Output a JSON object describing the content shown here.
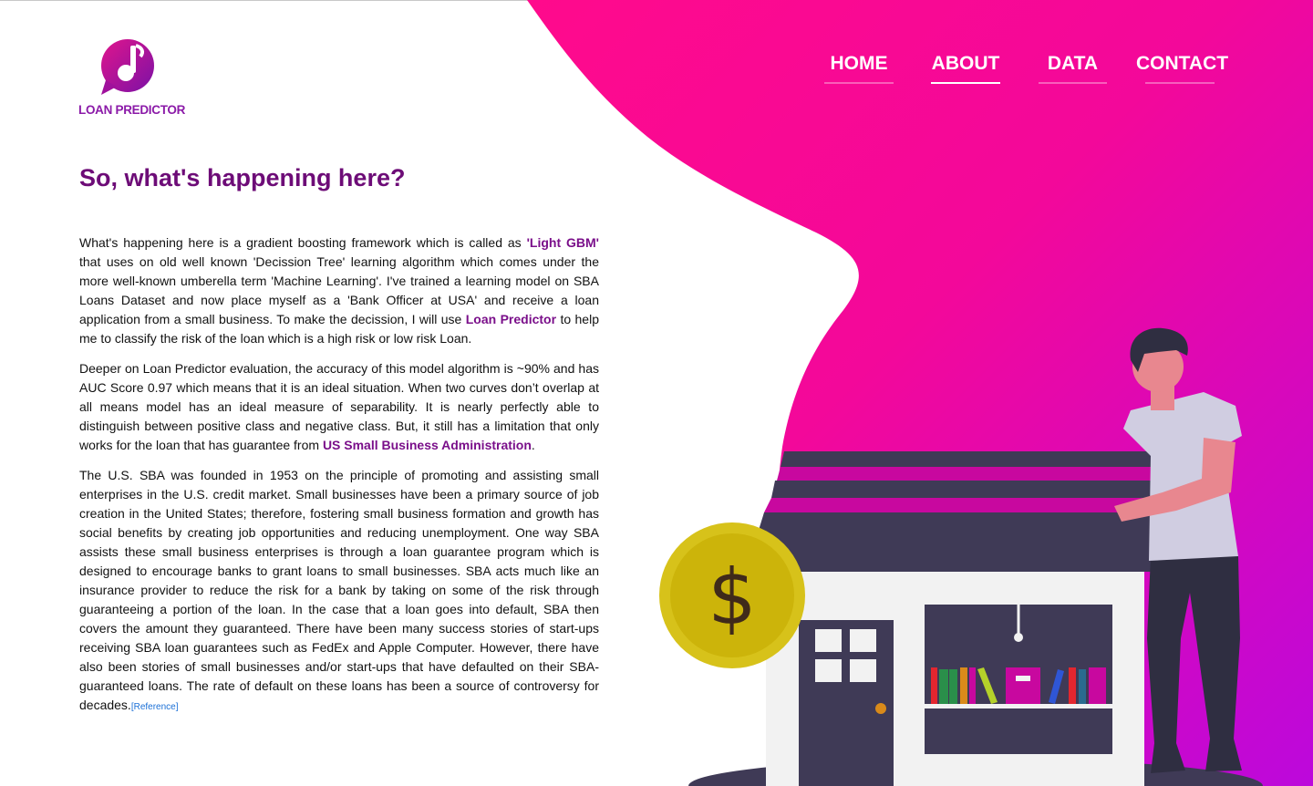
{
  "brand": {
    "name": "LOAN PREDICTOR",
    "colors": {
      "primary": "#6d0c77",
      "accent_pink": "#ff0a8c",
      "accent_purple": "#bd08d9"
    }
  },
  "nav": {
    "items": [
      {
        "label": "HOME",
        "active": false
      },
      {
        "label": "ABOUT",
        "active": true
      },
      {
        "label": "DATA",
        "active": false
      },
      {
        "label": "CONTACT",
        "active": false
      }
    ]
  },
  "main": {
    "title": "So, what's happening here?",
    "p1": {
      "a": "What's happening here is a gradient boosting framework which is called as ",
      "b": "'Light GBM'",
      "c": " that uses on old well known 'Decission Tree' learning algorithm which comes under the more well-known umberella term 'Machine Learning'. I've trained a learning model on SBA Loans Dataset and now place myself as a 'Bank Officer at USA' and receive a loan application from a small business. To make the decission, I will use ",
      "d": "Loan Predictor",
      "e": " to help me to classify the risk of the loan which is a high risk or low risk Loan."
    },
    "p2": {
      "a": "Deeper on Loan Predictor evaluation, the accuracy of this model algorithm is ~90% and has AUC Score 0.97 which means that it is an ideal situation. When two curves don’t overlap at all means model has an ideal measure of separability. It is nearly perfectly able to distinguish between positive class and negative class. But, it still has a limitation that only works for the loan that has guarantee from ",
      "b": "US Small Business Administration",
      "c": "."
    },
    "p3": {
      "a": "The U.S. SBA was founded in 1953 on the principle of promoting and assisting small enterprises in the U.S. credit market. Small businesses have been a primary source of job creation in the United States; therefore, fostering small business formation and growth has social benefits by creating job opportunities and reducing unemployment. One way SBA assists these small business enterprises is through a loan guarantee program which is designed to encourage banks to grant loans to small businesses. SBA acts much like an insurance provider to reduce the risk for a bank by taking on some of the risk through guaranteeing a portion of the loan. In the case that a loan goes into default, SBA then covers the amount they guaranteed. There have been many success stories of start-ups receiving SBA loan guarantees such as FedEx and Apple Computer. However, there have also been stories of small businesses and/or start-ups that have defaulted on their SBA-guaranteed loans. The rate of default on these loans has been a source of controversy for decades.",
      "ref": "[Reference]"
    }
  },
  "illustration": {
    "coin_symbol": "$"
  }
}
